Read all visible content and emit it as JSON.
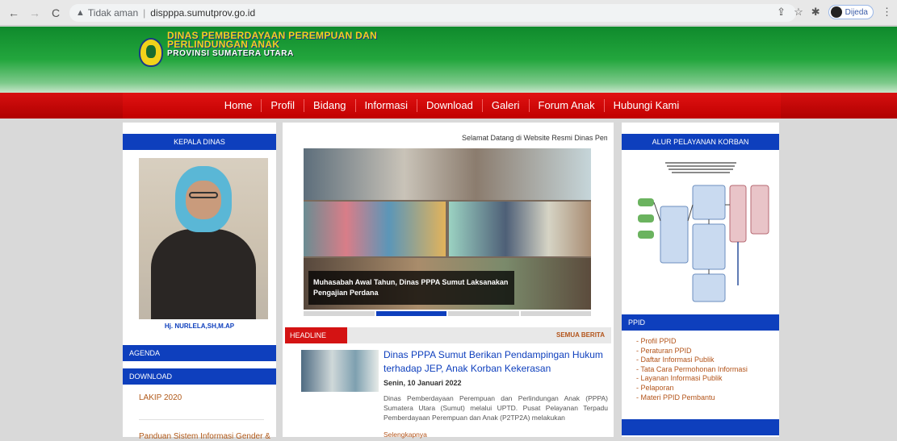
{
  "browser": {
    "security_label": "Tidak aman",
    "url": "dispppa.sumutprov.go.id",
    "profile_label": "Dijeda"
  },
  "header": {
    "title_line1": "DINAS PEMBERDAYAAN PEREMPUAN DAN",
    "title_line2": "PERLINDUNGAN ANAK",
    "title_line3": "PROVINSI SUMATERA UTARA"
  },
  "nav": {
    "items": [
      "Home",
      "Profil",
      "Bidang",
      "Informasi",
      "Download",
      "Galeri",
      "Forum Anak",
      "Hubungi Kami"
    ]
  },
  "left": {
    "kepala_title": "KEPALA DINAS",
    "kepala_name": "Hj. NURLELA,SH,M.AP",
    "agenda_title": "AGENDA",
    "download_title": "DOWNLOAD",
    "download_items": [
      "LAKIP 2020",
      "Panduan Sistem Informasi Gender &"
    ]
  },
  "middle": {
    "welcome": "Selamat Datang di Website Resmi Dinas Pemberdayaan",
    "slide_caption": "Muhasabah Awal Tahun, Dinas PPPA Sumut Laksanakan Pengajian Perdana",
    "headline_tab": "HEADLINE",
    "all_news": "SEMUA BERITA",
    "article_title": "Dinas PPPA Sumut Berikan Pendampingan Hukum terhadap JEP, Anak Korban Kekerasan",
    "article_date": "Senin, 10 Januari 2022",
    "article_excerpt": "Dinas Pemberdayaan Perempuan dan Perlindungan Anak (PPPA) Sumatera Utara (Sumut) melalui UPTD. Pusat Pelayanan Terpadu Pemberdayaan Perempuan dan Anak (P2TP2A) melakukan",
    "read_more": "Selengkapnya"
  },
  "right": {
    "alur_title": "ALUR PELAYANAN KORBAN",
    "ppid_title": "PPID",
    "ppid_items": [
      "Profil PPID",
      "Peraturan PPID",
      "Daftar Informasi Publik",
      "Tata Cara Permohonan Informasi",
      "Layanan Informasi Publik",
      "Pelaporan",
      "Materi PPID Pembantu"
    ]
  },
  "colors": {
    "header_green": "#23a63d",
    "nav_red": "#c10000",
    "section_blue": "#0e3fbd",
    "link_orange": "#b3541a"
  }
}
